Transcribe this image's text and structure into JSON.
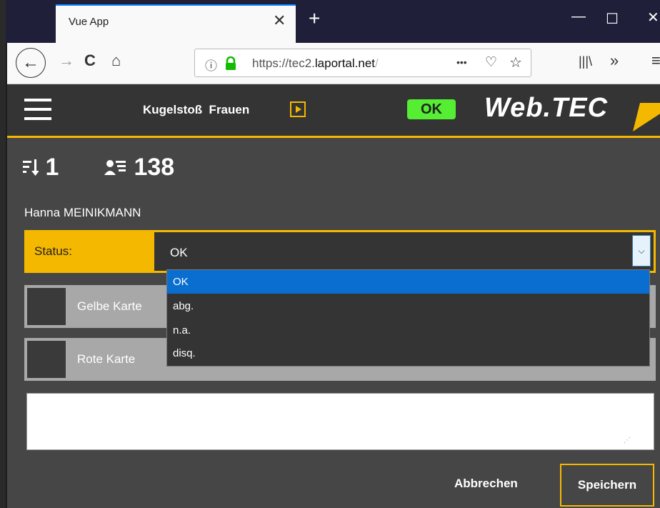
{
  "browser": {
    "tab_title": "Vue App",
    "url_host": "https://tec2.",
    "url_domain": "laportal.net",
    "url_tail": "/",
    "more_label": "•••",
    "overflow_label": "»"
  },
  "header": {
    "event_title": "Kugelstoß  Frauen",
    "status_badge": "OK",
    "brand": "Web.TEC"
  },
  "athlete": {
    "order_number": "1",
    "bib_number": "138",
    "name": "Hanna MEINIKMANN"
  },
  "status": {
    "label": "Status:",
    "value": "OK",
    "options": [
      "OK",
      "abg.",
      "n.a.",
      "disq."
    ],
    "selected_index": 0
  },
  "cards": {
    "yellow_label": "Gelbe Karte",
    "red_label": "Rote Karte"
  },
  "notes": {
    "value": ""
  },
  "actions": {
    "cancel_label": "Abbrechen",
    "save_label": "Speichern"
  },
  "colors": {
    "accent": "#f5b800",
    "ok_green": "#55ee33",
    "selection_blue": "#0a6ed1"
  }
}
